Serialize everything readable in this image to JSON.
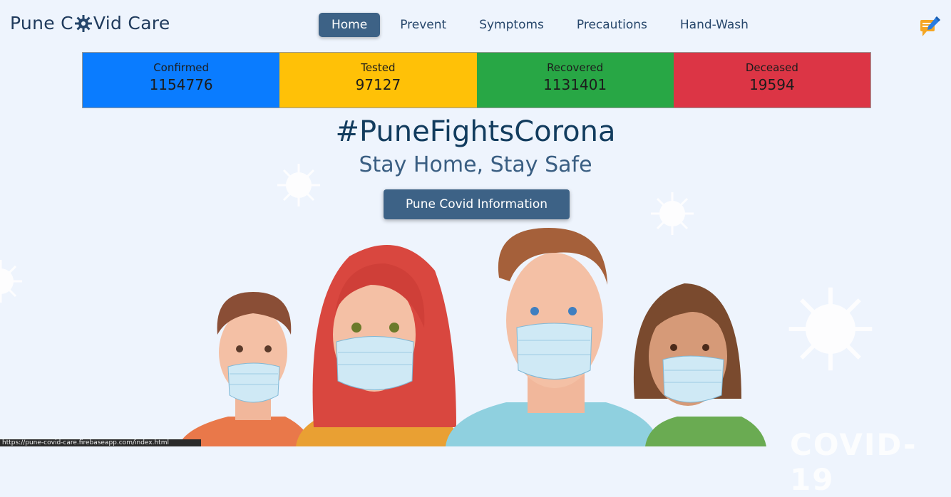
{
  "brand": {
    "prefix": "Pune C",
    "suffix": "Vid Care"
  },
  "nav": {
    "items": [
      {
        "label": "Home",
        "active": true
      },
      {
        "label": "Prevent",
        "active": false
      },
      {
        "label": "Symptoms",
        "active": false
      },
      {
        "label": "Precautions",
        "active": false
      },
      {
        "label": "Hand-Wash",
        "active": false
      }
    ]
  },
  "stats": [
    {
      "label": "Confirmed",
      "value": "1154776",
      "color": "#0a7cff"
    },
    {
      "label": "Tested",
      "value": "97127",
      "color": "#ffc107"
    },
    {
      "label": "Recovered",
      "value": "1131401",
      "color": "#28a745"
    },
    {
      "label": "Deceased",
      "value": "19594",
      "color": "#dc3545"
    }
  ],
  "hero": {
    "title": "#PuneFightsCorona",
    "subtitle": "Stay Home, Stay Safe",
    "cta_label": "Pune Covid Information"
  },
  "status_url": "https://pune-covid-care.firebaseapp.com/index.html",
  "watermark": "COVID-19",
  "colors": {
    "accent": "#3d6286",
    "background": "#eef4fd"
  }
}
